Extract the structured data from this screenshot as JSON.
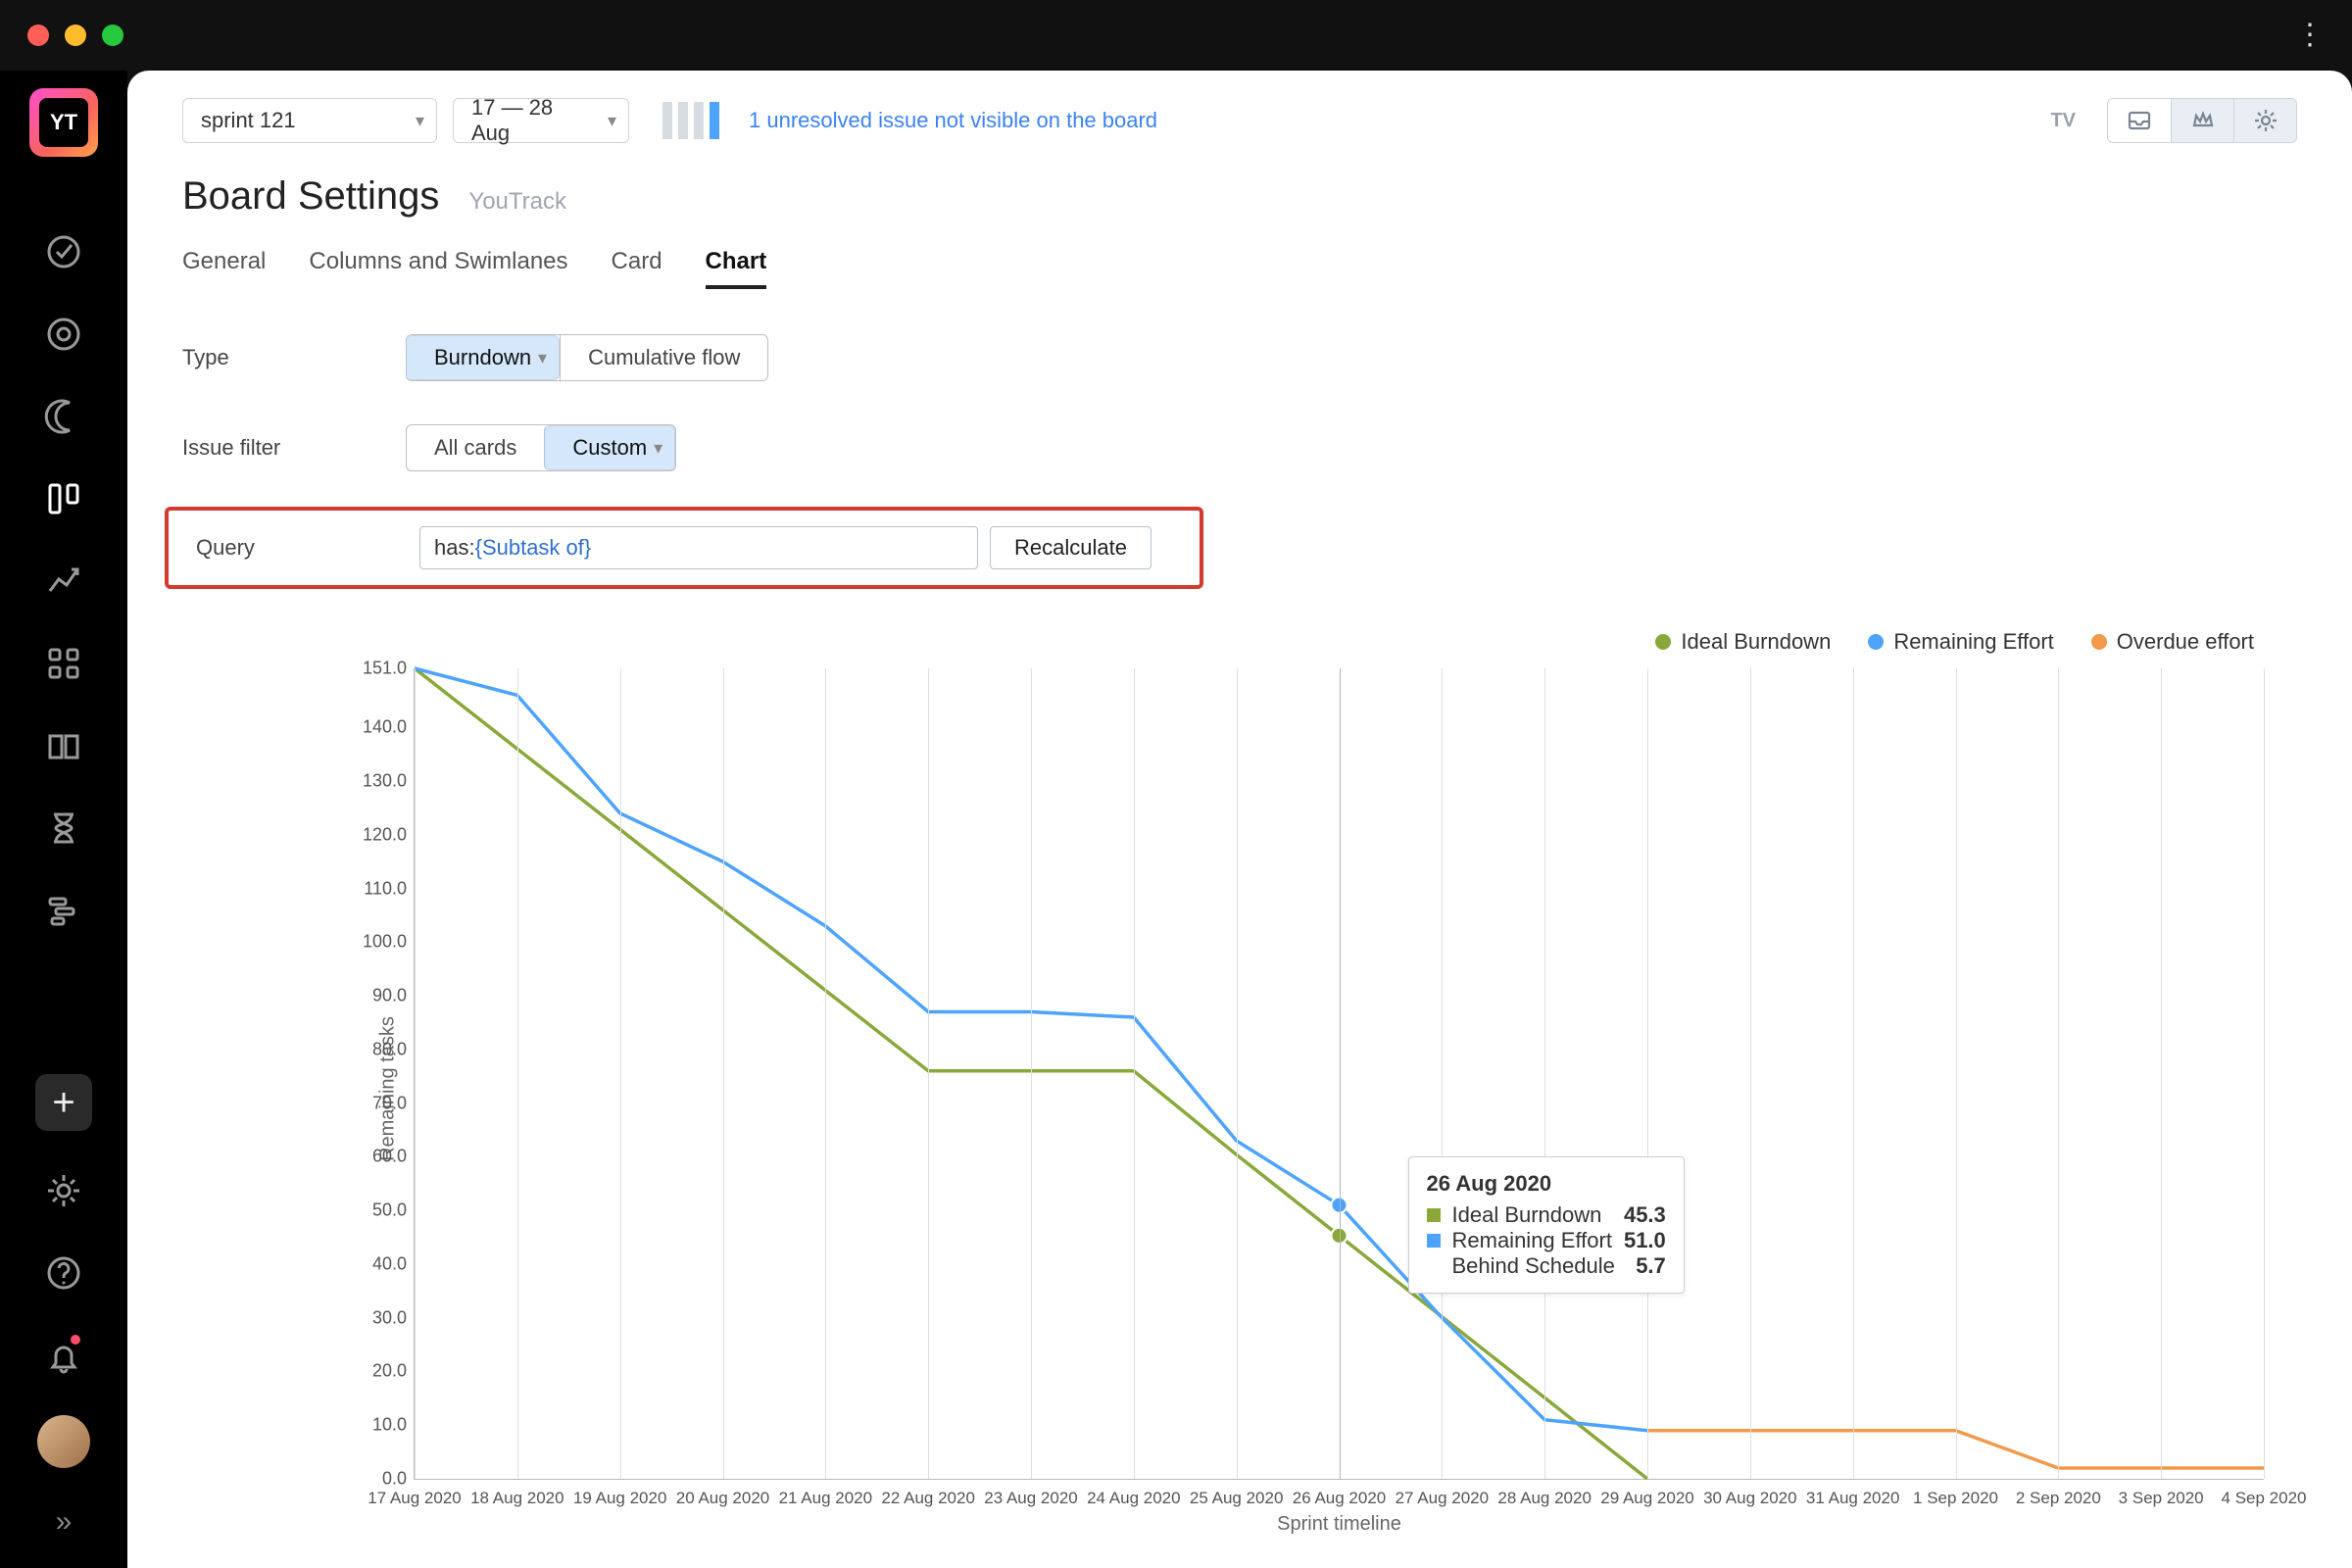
{
  "window": {
    "kebab": "⋮"
  },
  "sidebar": {
    "logo_text": "YT",
    "plus": "+",
    "chevrons": "»"
  },
  "header": {
    "sprint_select": "sprint 121",
    "date_range": "17 — 28 Aug",
    "warning_link": "1 unresolved issue not visible on the board",
    "tv": "TV"
  },
  "title": "Board Settings",
  "subtitle": "YouTrack",
  "tabs": {
    "general": "General",
    "columns": "Columns and Swimlanes",
    "card": "Card",
    "chart": "Chart"
  },
  "form": {
    "type_label": "Type",
    "type_options": {
      "burndown": "Burndown",
      "cumulative": "Cumulative flow"
    },
    "filter_label": "Issue filter",
    "filter_options": {
      "all": "All cards",
      "custom": "Custom"
    },
    "query_label": "Query",
    "query_prefix": "has: ",
    "query_token": "{Subtask of}",
    "recalculate": "Recalculate"
  },
  "legend": {
    "ideal": "Ideal Burndown",
    "remaining": "Remaining Effort",
    "overdue": "Overdue effort"
  },
  "axes": {
    "y_title": "Remaining tasks",
    "x_title": "Sprint timeline"
  },
  "colors": {
    "ideal": "#8aa83a",
    "remaining": "#4da3ff",
    "overdue": "#f2994a"
  },
  "tooltip": {
    "date": "26 Aug 2020",
    "rows": [
      {
        "label": "Ideal Burndown",
        "value": "45.3",
        "color": "#8aa83a"
      },
      {
        "label": "Remaining Effort",
        "value": "51.0",
        "color": "#4da3ff"
      },
      {
        "label": "Behind Schedule",
        "value": "5.7",
        "color": ""
      }
    ]
  },
  "chart_data": {
    "type": "line",
    "xlabel": "Sprint timeline",
    "ylabel": "Remaining tasks",
    "ylim": [
      0,
      151
    ],
    "yticks": [
      "0.0",
      "10.0",
      "20.0",
      "30.0",
      "40.0",
      "50.0",
      "60.0",
      "70.0",
      "80.0",
      "90.0",
      "100.0",
      "110.0",
      "120.0",
      "130.0",
      "140.0",
      "151.0"
    ],
    "categories": [
      "17 Aug 2020",
      "18 Aug 2020",
      "19 Aug 2020",
      "20 Aug 2020",
      "21 Aug 2020",
      "22 Aug 2020",
      "23 Aug 2020",
      "24 Aug 2020",
      "25 Aug 2020",
      "26 Aug 2020",
      "27 Aug 2020",
      "28 Aug 2020",
      "29 Aug 2020",
      "30 Aug 2020",
      "31 Aug 2020",
      "1 Sep 2020",
      "2 Sep 2020",
      "3 Sep 2020",
      "4 Sep 2020"
    ],
    "series": [
      {
        "name": "Ideal Burndown",
        "color": "#8aa83a",
        "values": [
          151,
          136,
          121,
          106,
          91,
          76,
          76,
          76,
          60.4,
          45.3,
          30.2,
          15.1,
          0,
          null,
          null,
          null,
          null,
          null,
          null
        ]
      },
      {
        "name": "Remaining Effort",
        "color": "#4da3ff",
        "values": [
          151,
          146,
          124,
          115,
          103,
          87,
          87,
          86,
          63,
          51,
          30,
          11,
          9,
          9,
          9,
          9,
          null,
          null,
          null
        ]
      },
      {
        "name": "Overdue effort",
        "color": "#f2994a",
        "values": [
          null,
          null,
          null,
          null,
          null,
          null,
          null,
          null,
          null,
          null,
          null,
          null,
          9,
          9,
          9,
          9,
          2,
          2,
          2
        ]
      }
    ]
  }
}
